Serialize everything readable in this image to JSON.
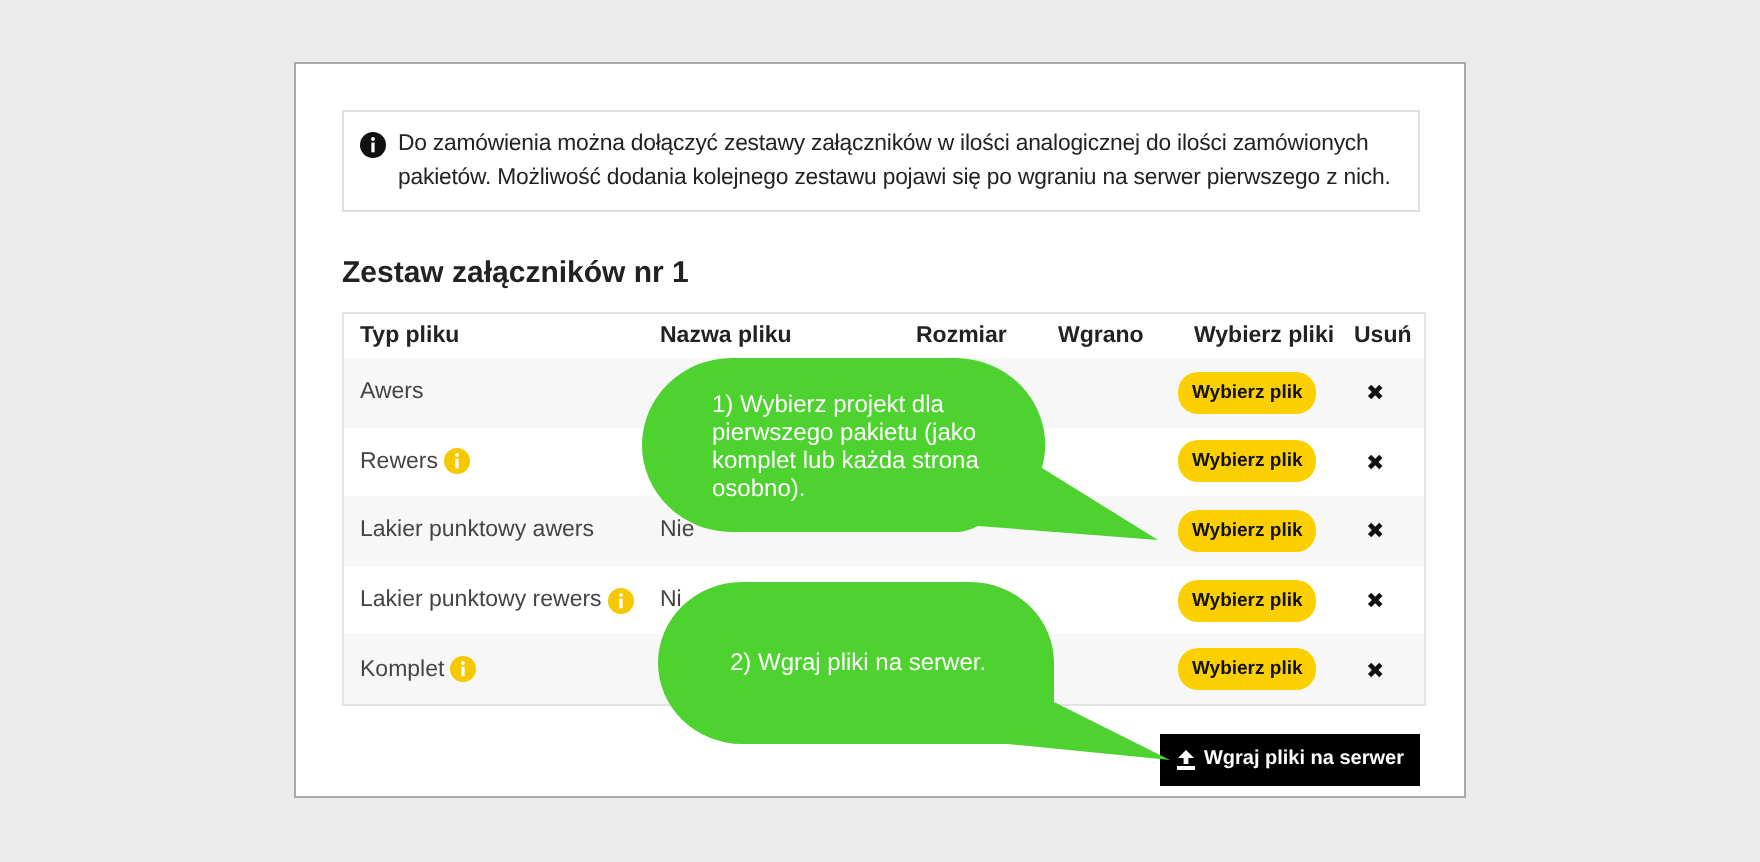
{
  "notice": {
    "text": "Do zamówienia można dołączyć zestawy załączników w ilości analogicznej do ilości zamówionych pakietów. Możliwość dodania kolejnego zestawu pojawi się po wgraniu na serwer pierwszego z nich."
  },
  "section_title": "Zestaw załączników nr 1",
  "table": {
    "columns": [
      "Typ pliku",
      "Nazwa pliku",
      "Rozmiar",
      "Wgrano",
      "Wybierz pliki",
      "Usuń"
    ],
    "rows": [
      {
        "type": "Awers",
        "info": false,
        "name": "",
        "choose": "Wybierz plik",
        "remove": "✖"
      },
      {
        "type": "Rewers",
        "info": true,
        "name": "",
        "choose": "Wybierz plik",
        "remove": "✖"
      },
      {
        "type": "Lakier punktowy awers",
        "info": false,
        "name": "Nie",
        "choose": "Wybierz plik",
        "remove": "✖"
      },
      {
        "type": "Lakier punktowy rewers",
        "info": true,
        "name": "Ni",
        "choose": "Wybierz plik",
        "remove": "✖"
      },
      {
        "type": "Komplet",
        "info": true,
        "name": "",
        "choose": "Wybierz plik",
        "remove": "✖"
      }
    ]
  },
  "upload_button": "Wgraj pliki na serwer",
  "callouts": [
    {
      "text": "1) Wybierz projekt dla pierwszego pakietu (jako komplet lub każda strona osobno)."
    },
    {
      "text": "2) Wgraj pliki na serwer."
    }
  ]
}
